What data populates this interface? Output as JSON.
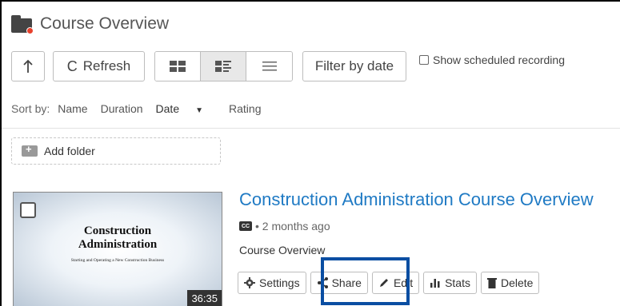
{
  "header": {
    "title": "Course Overview",
    "folder_icon": "folder-icon"
  },
  "toolbar": {
    "up_icon": "arrow-up-icon",
    "refresh_label": "Refresh",
    "view_modes": [
      "grid-view",
      "detail-view",
      "list-view"
    ],
    "active_view": "detail-view",
    "filter_label": "Filter by date",
    "show_scheduled_label": "Show scheduled recording",
    "show_scheduled_checked": false
  },
  "sort": {
    "label": "Sort by:",
    "options": [
      "Name",
      "Duration",
      "Date",
      "Rating"
    ],
    "active": "Date",
    "direction_icon": "▼"
  },
  "add_folder": {
    "label": "Add folder"
  },
  "session": {
    "title": "Construction Administration Course Overview",
    "cc": "CC",
    "age": "• 2 months ago",
    "folder": "Course Overview",
    "duration": "36:35",
    "thumb_title_line1": "Construction",
    "thumb_title_line2": "Administration",
    "thumb_subtitle": "Starting and Operating a New Construction Business",
    "selected": false,
    "actions": {
      "settings": "Settings",
      "share": "Share",
      "edit": "Edit",
      "stats": "Stats",
      "delete": "Delete"
    }
  },
  "colors": {
    "link": "#1f7ac4",
    "highlight": "#0a4ea2",
    "folder_dot": "#e8412c"
  }
}
